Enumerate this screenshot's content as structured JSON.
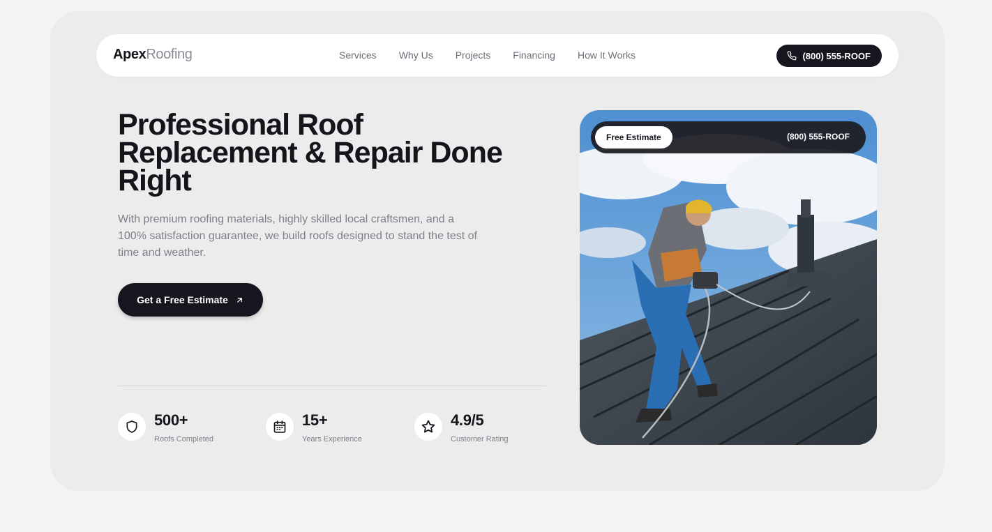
{
  "nav": {
    "logo_bold": "Apex",
    "logo_light": "Roofing",
    "links": [
      "Services",
      "Why Us",
      "Projects",
      "Financing",
      "How It Works"
    ],
    "phone": "(800) 555-ROOF"
  },
  "hero": {
    "title": "Professional Roof Replacement & Repair Done Right",
    "subtitle": "With premium roofing materials, highly skilled local craftsmen, and a 100% satisfaction guarantee, we build roofs designed to stand the test of time and weather.",
    "cta": "Get a Free Estimate"
  },
  "stats": [
    {
      "value": "500+",
      "label": "Roofs Completed",
      "icon": "shield-icon"
    },
    {
      "value": "15+",
      "label": "Years Experience",
      "icon": "calendar-icon"
    },
    {
      "value": "4.9/5",
      "label": "Customer Rating",
      "icon": "star-icon"
    }
  ],
  "photo_card": {
    "pill": "Free Estimate",
    "phone": "(800) 555-ROOF"
  },
  "colors": {
    "primary": "#16161e",
    "muted_text": "#7d808a",
    "page_bg": "#f4f4f4",
    "panel_bg": "#ececec"
  }
}
